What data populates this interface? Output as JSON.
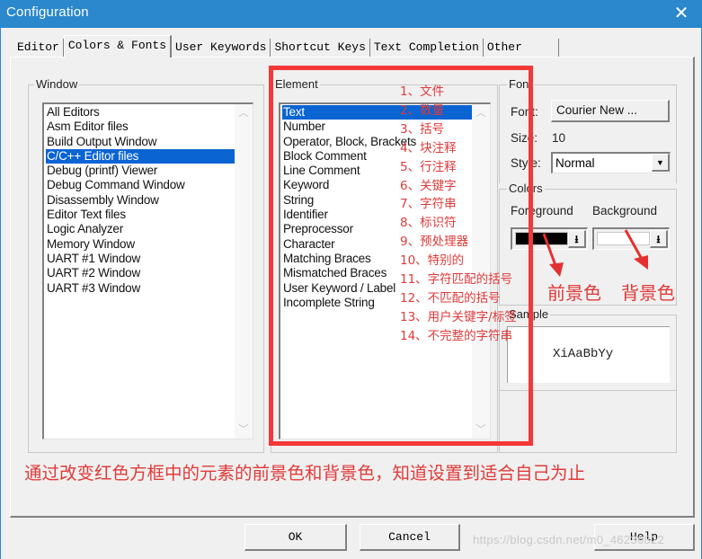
{
  "window": {
    "title": "Configuration",
    "close_glyph": "✕"
  },
  "tabs": [
    {
      "label": "Editor",
      "active": false
    },
    {
      "label": "Colors & Fonts",
      "active": true
    },
    {
      "label": "User Keywords",
      "active": false
    },
    {
      "label": "Shortcut Keys",
      "active": false
    },
    {
      "label": "Text Completion",
      "active": false
    },
    {
      "label": "Other",
      "active": false
    }
  ],
  "window_group": {
    "label": "Window",
    "items": [
      "All Editors",
      "Asm Editor files",
      "Build Output Window",
      "C/C++ Editor files",
      "Debug (printf) Viewer",
      "Debug Command Window",
      "Disassembly Window",
      "Editor Text files",
      "Logic Analyzer",
      "Memory Window",
      "UART #1 Window",
      "UART #2 Window",
      "UART #3 Window"
    ],
    "selected_index": 3
  },
  "element_group": {
    "label": "Element",
    "items": [
      "Text",
      "Number",
      "Operator, Block, Brackets",
      "Block Comment",
      "Line Comment",
      "Keyword",
      "String",
      "Identifier",
      "Preprocessor",
      "Character",
      "Matching Braces",
      "Mismatched Braces",
      "User Keyword / Label",
      "Incomplete String"
    ],
    "selected_index": 0
  },
  "font_group": {
    "label": "Font",
    "font_label": "Font:",
    "font_value": "Courier New ...",
    "size_label": "Size:",
    "size_value": "10",
    "style_label": "Style:",
    "style_value": "Normal"
  },
  "colors_group": {
    "label": "Colors",
    "foreground_label": "Foreground",
    "background_label": "Background",
    "foreground_color": "#000000",
    "background_color": "#ffffff",
    "drop_glyph": "⭳"
  },
  "sample_group": {
    "label": "Sample",
    "text": "XiAaBbYy"
  },
  "buttons": {
    "ok": "OK",
    "cancel": "Cancel",
    "help": "Help"
  },
  "annotations": {
    "element_translations": [
      "1、文件",
      "2、数量",
      "3、括号",
      "4、块注释",
      "5、行注释",
      "6、关键字",
      "7、字符串",
      "8、标识符",
      "9、预处理器",
      "10、特别的",
      "11、字符匹配的括号",
      "12、不匹配的括号",
      "13、用户关键字/标签",
      "14、不完整的字符串"
    ],
    "foreground_note": "前景色",
    "background_note": "背景色",
    "instruction": "通过改变红色方框中的元素的前景色和背景色，知道设置到适合自己为止",
    "color": "#e03a3a"
  },
  "watermark": "https://blog.csdn.net/m0_46236822"
}
